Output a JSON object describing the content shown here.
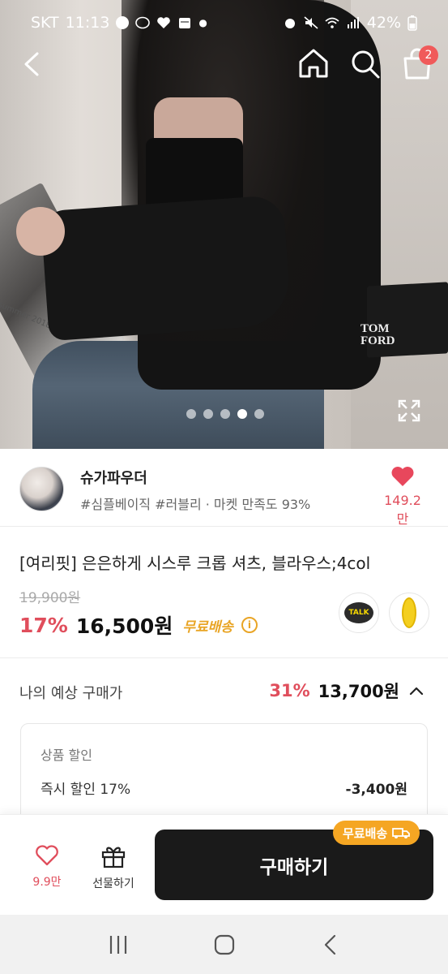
{
  "status_bar": {
    "carrier": "SKT",
    "time": "11:13",
    "battery": "42%"
  },
  "cart": {
    "badge_count": "2"
  },
  "hero": {
    "book_text": "nd summer 2018",
    "book2_text": "TOM FORD",
    "carousel_total": 5,
    "carousel_active_index": 3
  },
  "seller": {
    "name": "슈가파우더",
    "tags": "#심플베이직 #러블리 · 마켓 만족도 93%",
    "like_count": "149.2만"
  },
  "product": {
    "title": "[여리핏] 은은하게 시스루 크롭 셔츠, 블라우스;4col",
    "original_price": "19,900원",
    "discount_rate": "17%",
    "price": "16,500원",
    "free_shipping": "무료배송",
    "talk_label": "TALK"
  },
  "expected": {
    "label": "나의 예상 구매가",
    "rate": "31%",
    "price": "13,700원"
  },
  "discount_card": {
    "title": "상품 할인",
    "row_label": "즉시 할인 17%",
    "row_value": "-3,400원"
  },
  "bottom_bar": {
    "wish_count": "9.9만",
    "gift_label": "선물하기",
    "buy_label": "구매하기",
    "ship_badge": "무료배송"
  },
  "colors": {
    "accent_red": "#e04e5c",
    "accent_orange": "#f5a623",
    "buy_button": "#1a1a1a"
  }
}
